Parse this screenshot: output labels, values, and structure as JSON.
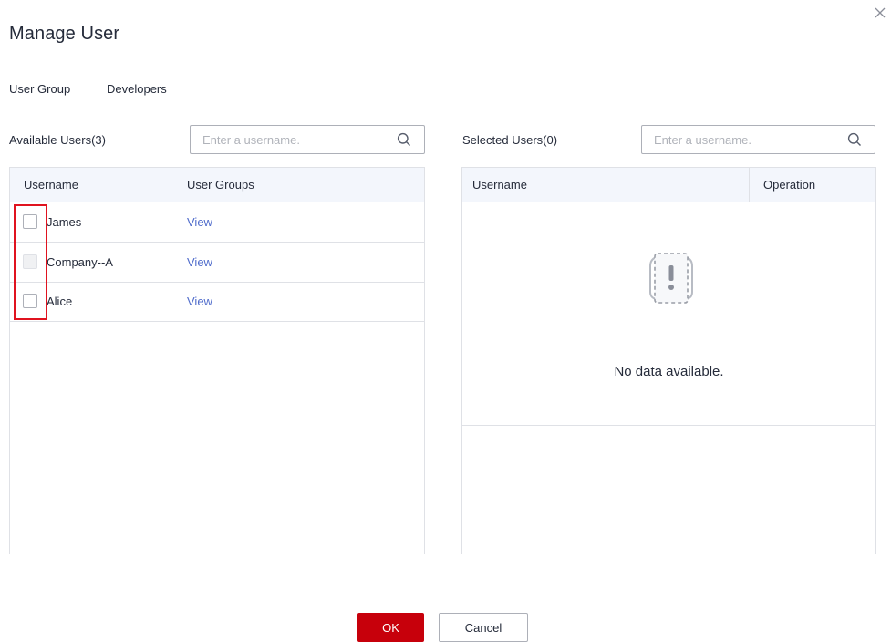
{
  "dialog": {
    "title": "Manage User",
    "close_icon": "close-icon",
    "user_group_label": "User Group",
    "user_group_value": "Developers"
  },
  "available": {
    "label": "Available Users(3)",
    "search_placeholder": "Enter a username.",
    "columns": [
      "Username",
      "User Groups"
    ],
    "rows": [
      {
        "username": "James",
        "link": "View",
        "disabled": false,
        "checked": false
      },
      {
        "username": "Company--A",
        "link": "View",
        "disabled": true,
        "checked": false
      },
      {
        "username": "Alice",
        "link": "View",
        "disabled": false,
        "checked": false
      }
    ]
  },
  "selected": {
    "label": "Selected Users(0)",
    "search_placeholder": "Enter a username.",
    "columns": [
      "Username",
      "Operation"
    ],
    "empty_text": "No data available."
  },
  "footer": {
    "ok_label": "OK",
    "cancel_label": "Cancel"
  },
  "colors": {
    "primary": "#c7000b",
    "link": "#526ecc",
    "highlight": "#e0131f",
    "header_bg": "#f3f6fc"
  }
}
